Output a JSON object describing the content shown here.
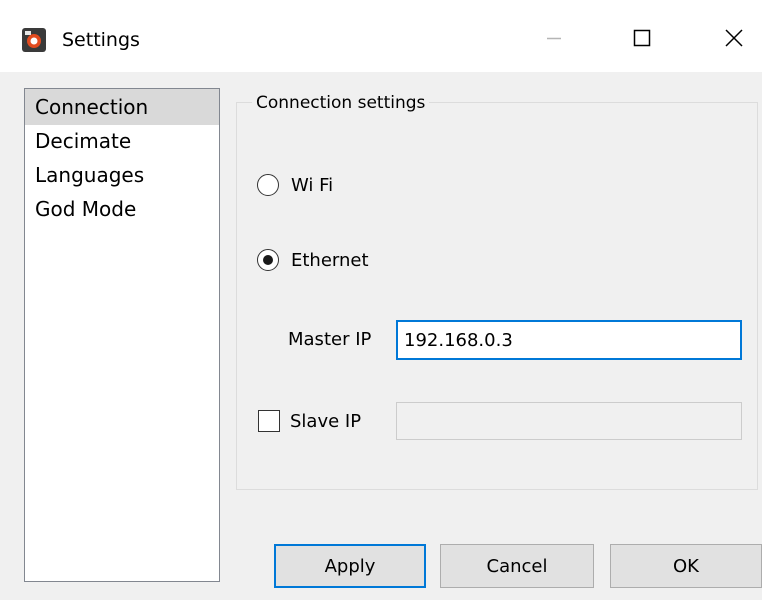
{
  "window": {
    "title": "Settings",
    "icon": "app-logo-icon",
    "controls": {
      "minimize": "minimize-icon",
      "maximize": "maximize-icon",
      "close": "close-icon"
    }
  },
  "sidebar": {
    "items": [
      {
        "label": "Connection",
        "selected": true
      },
      {
        "label": "Decimate",
        "selected": false
      },
      {
        "label": "Languages",
        "selected": false
      },
      {
        "label": "God Mode",
        "selected": false
      }
    ]
  },
  "connection": {
    "group_title": "Connection settings",
    "wifi_label": "Wi Fi",
    "wifi_selected": false,
    "ethernet_label": "Ethernet",
    "ethernet_selected": true,
    "master_ip_label": "Master IP",
    "master_ip_value": "192.168.0.3",
    "slave_ip_label": "Slave IP",
    "slave_ip_checked": false,
    "slave_ip_value": ""
  },
  "buttons": {
    "apply": "Apply",
    "cancel": "Cancel",
    "ok": "OK"
  },
  "colors": {
    "accent": "#0078d7",
    "selection": "#d9d9d9",
    "window_bg": "#f0f0f0"
  }
}
